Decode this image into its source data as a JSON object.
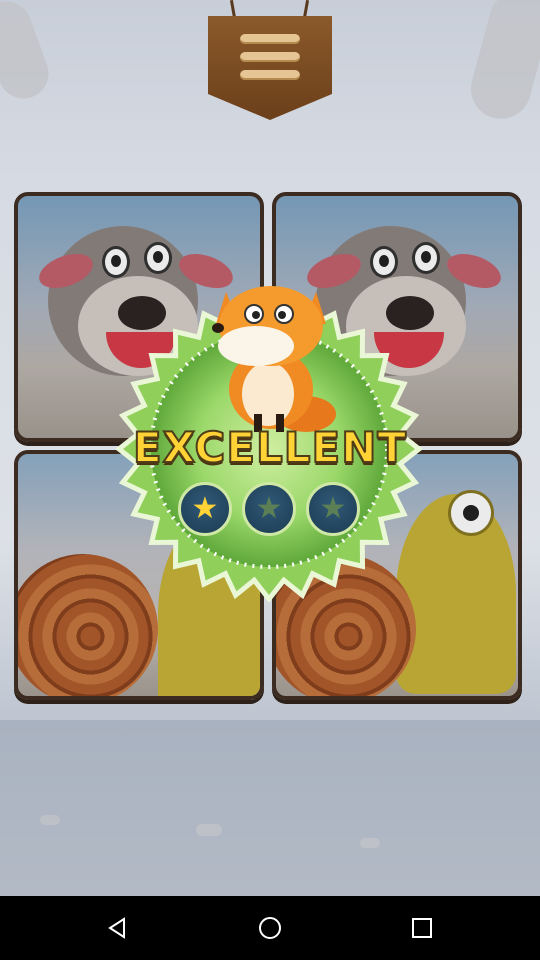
{
  "game": {
    "result_text": "EXCELLENT",
    "stars_earned": 1,
    "stars_total": 3,
    "menu_icon": "menu-sign-icon",
    "cards": [
      {
        "picture": "dog"
      },
      {
        "picture": "dog"
      },
      {
        "picture": "snail"
      },
      {
        "picture": "snail"
      }
    ]
  },
  "colors": {
    "badge_green": "#7cc04a",
    "star_filled": "#ffd236",
    "star_empty": "#5c7f55",
    "title_yellow": "#ffd236"
  },
  "navbar": {
    "back_icon": "back-icon",
    "home_icon": "home-icon",
    "recents_icon": "recents-icon"
  }
}
